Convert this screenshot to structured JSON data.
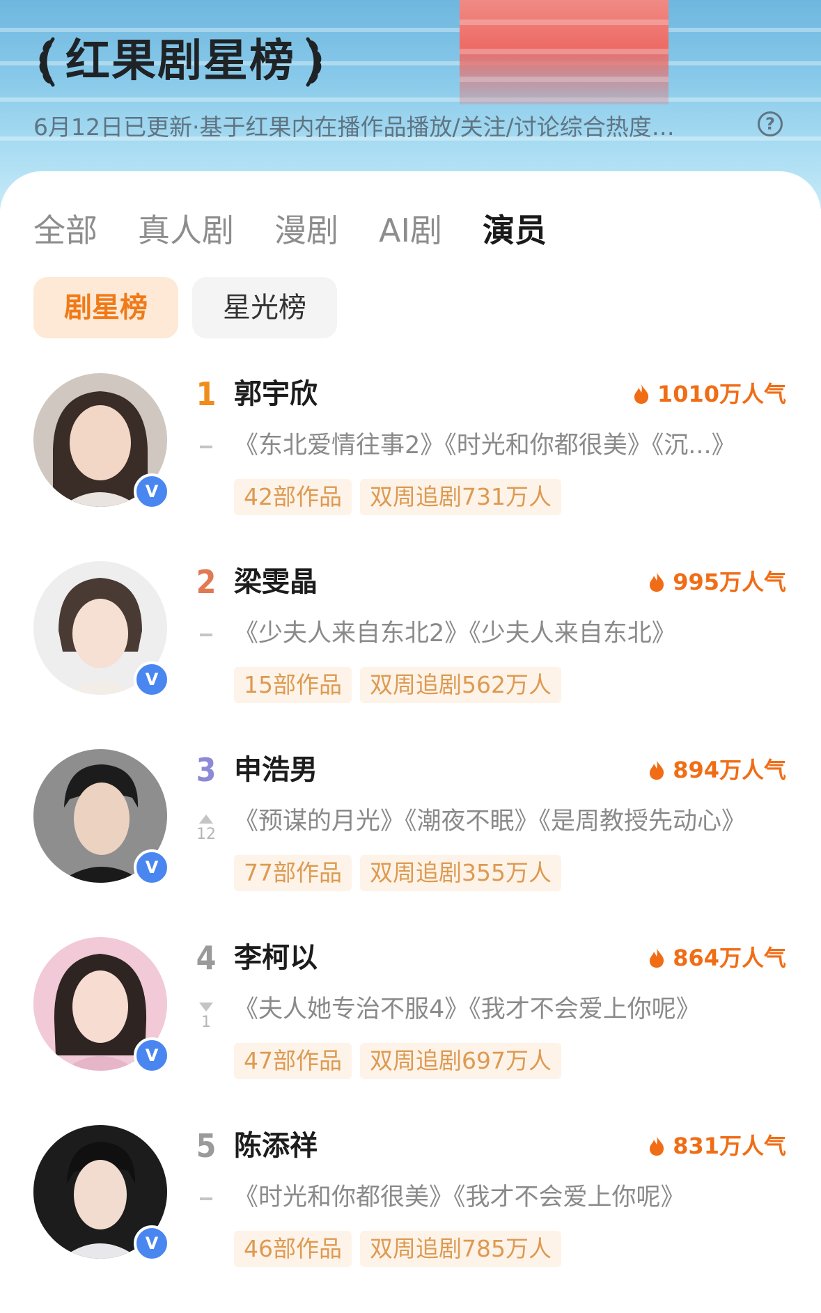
{
  "header": {
    "title": "红果剧星榜",
    "subtitle": "6月12日已更新·基于红果内在播作品播放/关注/讨论综合热度…",
    "help_icon": "?"
  },
  "tabs": [
    {
      "label": "全部",
      "active": false
    },
    {
      "label": "真人剧",
      "active": false
    },
    {
      "label": "漫剧",
      "active": false
    },
    {
      "label": "AI剧",
      "active": false
    },
    {
      "label": "演员",
      "active": true
    }
  ],
  "subtabs": [
    {
      "label": "剧星榜",
      "active": true
    },
    {
      "label": "星光榜",
      "active": false
    }
  ],
  "colors": {
    "accent_orange": "#f06d16",
    "tag_text": "#dd9a52",
    "tag_bg": "#fdf3e8",
    "rank1": "#f08c1c",
    "rank2": "#e07a52",
    "rank3": "#8d89d6",
    "rank_other": "#9a9a9a",
    "verified_badge": "#4a86f0"
  },
  "verified_label": "V",
  "actors": [
    {
      "rank": "1",
      "name": "郭宇欣",
      "heat": "1010万人气",
      "trend": "none",
      "trend_value": "",
      "works": "《东北爱情往事2》《时光和你都很美》《沉...》",
      "works_count": "42部作品",
      "followers": "双周追剧731万人"
    },
    {
      "rank": "2",
      "name": "梁雯晶",
      "heat": "995万人气",
      "trend": "none",
      "trend_value": "",
      "works": "《少夫人来自东北2》《少夫人来自东北》",
      "works_count": "15部作品",
      "followers": "双周追剧562万人"
    },
    {
      "rank": "3",
      "name": "申浩男",
      "heat": "894万人气",
      "trend": "up",
      "trend_value": "12",
      "works": "《预谋的月光》《潮夜不眠》《是周教授先动心》",
      "works_count": "77部作品",
      "followers": "双周追剧355万人"
    },
    {
      "rank": "4",
      "name": "李柯以",
      "heat": "864万人气",
      "trend": "down",
      "trend_value": "1",
      "works": "《夫人她专治不服4》《我才不会爱上你呢》",
      "works_count": "47部作品",
      "followers": "双周追剧697万人"
    },
    {
      "rank": "5",
      "name": "陈添祥",
      "heat": "831万人气",
      "trend": "none",
      "trend_value": "",
      "works": "《时光和你都很美》《我才不会爱上你呢》",
      "works_count": "46部作品",
      "followers": "双周追剧785万人"
    }
  ]
}
